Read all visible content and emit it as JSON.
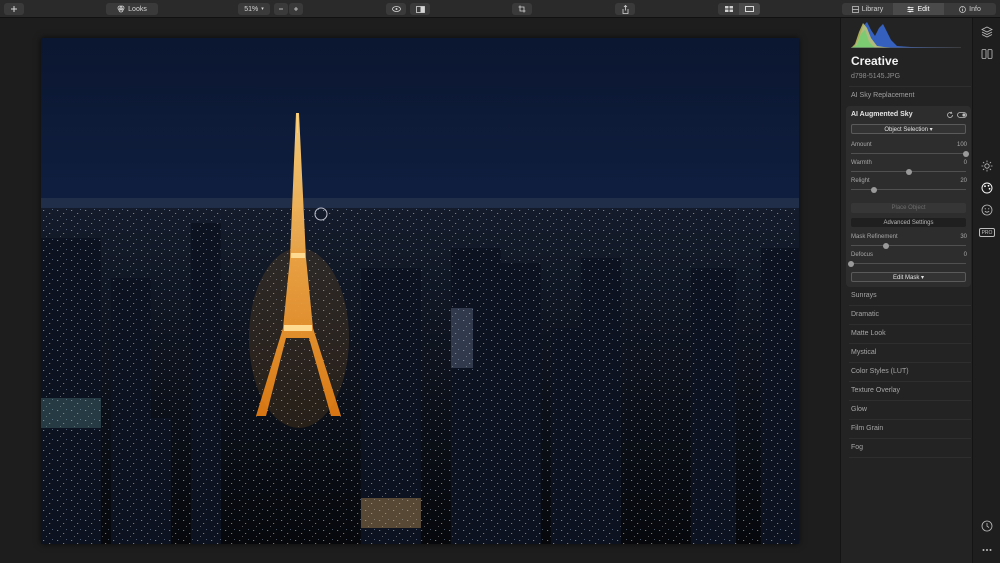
{
  "toolbar": {
    "looks_label": "Looks",
    "zoom_value": "51%",
    "tabs": [
      {
        "label": "Library",
        "icon": "library-icon"
      },
      {
        "label": "Edit",
        "icon": "sliders-icon"
      },
      {
        "label": "Info",
        "icon": "info-icon"
      }
    ],
    "active_tab": "Edit"
  },
  "panel": {
    "title": "Creative",
    "file_name": "d798-5145.JPG",
    "section_above": "AI Sky Replacement",
    "active_tool": {
      "title": "AI Augmented Sky",
      "selection_dropdown": "Object Selection ▾",
      "sliders": [
        {
          "label": "Amount",
          "value": "100",
          "fraction": 1.0
        },
        {
          "label": "Warmth",
          "value": "0",
          "fraction": 0.5
        },
        {
          "label": "Relight",
          "value": "20",
          "fraction": 0.2
        }
      ],
      "place_object_label": "Place Object",
      "advanced_label": "Advanced Settings",
      "sliders2": [
        {
          "label": "Mask Refinement",
          "value": "30",
          "fraction": 0.3
        },
        {
          "label": "Defocus",
          "value": "0",
          "fraction": 0.0
        }
      ],
      "edit_mask_label": "Edit Mask ▾"
    },
    "tools": [
      "Sunrays",
      "Dramatic",
      "Matte Look",
      "Mystical",
      "Color Styles (LUT)",
      "Texture Overlay",
      "Glow",
      "Film Grain",
      "Fog"
    ]
  },
  "rail": {
    "icons": [
      "layers-icon",
      "compare-icon",
      "sun-icon",
      "palette-icon",
      "face-icon",
      "pro-badge",
      "history-icon",
      "more-icon"
    ],
    "pro_label": "PRO"
  },
  "colors": {
    "accent": "#3a3a3a",
    "panel_bg": "#232323",
    "sky_top": "#0d1b38",
    "tower_glow": "#f59a2a"
  }
}
